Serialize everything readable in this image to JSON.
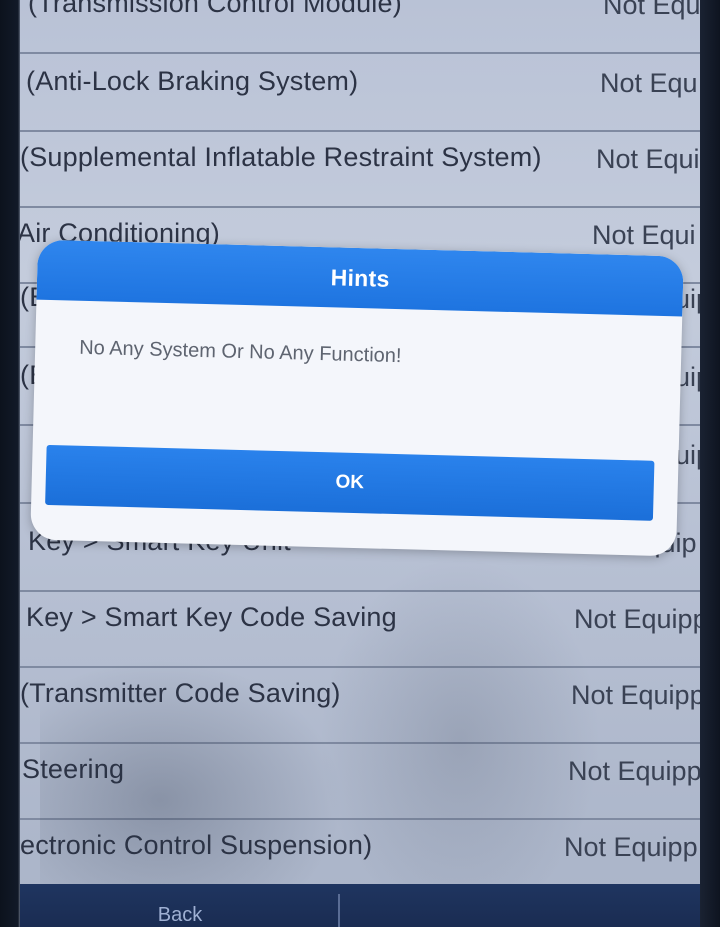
{
  "system_list": [
    {
      "name": "(Transmission Control Module)",
      "status": "Not Equ"
    },
    {
      "name": "(Anti-Lock Braking System)",
      "status": "Not Equ"
    },
    {
      "name": "(Supplemental Inflatable Restraint System)",
      "status": "Not Equi"
    },
    {
      "name": "Air Conditioning)",
      "status": "Not Equi"
    },
    {
      "name": "(E",
      "status": "uip"
    },
    {
      "name": "(E",
      "status": "uip"
    },
    {
      "name": ")",
      "status": "uip"
    },
    {
      "name": "Key > Smart Key Unit",
      "status": "Not Equip"
    },
    {
      "name": "Key > Smart Key Code Saving",
      "status": "Not Equipp"
    },
    {
      "name": "(Transmitter Code Saving)",
      "status": "Not Equipp"
    },
    {
      "name": "Steering",
      "status": "Not Equipp"
    },
    {
      "name": "ectronic Control Suspension)",
      "status": "Not Equipp"
    }
  ],
  "dialog": {
    "title": "Hints",
    "message": "No Any System Or No Any Function!",
    "ok_label": "OK"
  },
  "bottom_bar": {
    "back_label": "Back"
  },
  "colors": {
    "dialog_header": "#2f86ee",
    "ok_button": "#1e74e0",
    "bottom_bar": "#1f3560"
  }
}
